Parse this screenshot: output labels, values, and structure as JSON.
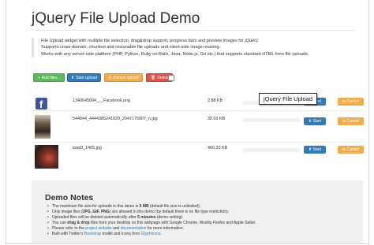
{
  "page": {
    "title": "jQuery File Upload Demo",
    "description": [
      "File Upload widget with multiple file selection, drag&drop support, progress bars and preview images for jQuery.",
      "Supports cross-domain, chunked and resumable file uploads and client-side image resizing.",
      "Works with any server-side platform (PHP, Python, Ruby on Rails, Java, Node.js, Go etc.) that supports standard HTML form file uploads."
    ]
  },
  "toolbar": {
    "add_label": "Add files...",
    "start_label": "Start upload",
    "cancel_label": "Cancel upload",
    "delete_label": "Delete"
  },
  "files": [
    {
      "name": "1340645094___Facebook.png",
      "size": "2.88 KB",
      "progress": 0,
      "start_label": "Start",
      "cancel_label": "Cancel",
      "thumb_icon": "facebook-icon"
    },
    {
      "name": "544844_4444385241020_2047175907_n.jpg",
      "size": "32.03 KB",
      "progress": 0,
      "start_label": "Start",
      "cancel_label": "Cancel",
      "thumb_icon": "photo-thumbnail"
    },
    {
      "name": "ipad3_1405.jpg",
      "size": "460.20 KB",
      "progress": 0,
      "start_label": "Start",
      "cancel_label": "Cancel",
      "thumb_icon": "photo-thumbnail"
    }
  ],
  "tooltip": "jQuery File Upload",
  "notes": {
    "title": "Demo Notes",
    "items": [
      {
        "pre": "The maximum file size for uploads in this demo is ",
        "bold": "5 MB",
        "post": " (default file size is unlimited)."
      },
      {
        "pre": "Only image files (",
        "bold": "JPG, GIF, PNG",
        "post": ") are allowed in this demo (by default there is no file type restriction)."
      },
      {
        "pre": "Uploaded files will be deleted automatically after ",
        "bold": "5 minutes",
        "post": " (demo setting)."
      },
      {
        "pre": "You can ",
        "bold": "drag & drop",
        "post": " files from your desktop on this webpage with Google Chrome, Mozilla Firefox and Apple Safari."
      },
      {
        "pre": "Please refer to the ",
        "link1": "project website",
        "mid": " and ",
        "link2": "documentation",
        "post": " for more information."
      },
      {
        "pre": "Built with Twitter's ",
        "link1": "Bootstrap",
        "mid": " toolkit and Icons from ",
        "link2": "Glyphicons",
        "post": "."
      }
    ]
  },
  "colors": {
    "success": "#5cb85c",
    "primary": "#337ab7",
    "warning": "#f0ad4e",
    "danger": "#d9534f"
  }
}
